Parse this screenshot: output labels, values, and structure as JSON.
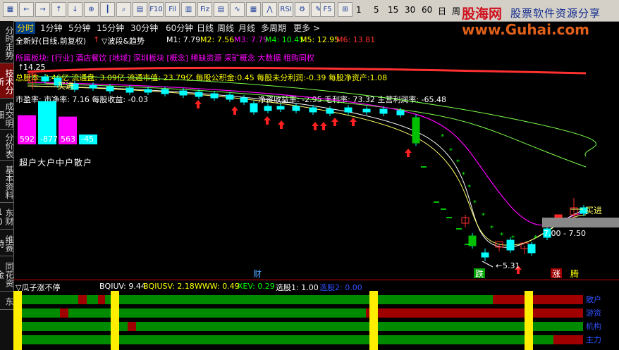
{
  "toolbar": {
    "icons": [
      {
        "name": "grid-icon",
        "glyph": "▦"
      },
      {
        "name": "left-arrow-icon",
        "glyph": "←"
      },
      {
        "name": "right-arrow-icon",
        "glyph": "→"
      },
      {
        "name": "up-arrow-icon",
        "glyph": "↑"
      },
      {
        "name": "down-arrow-icon",
        "glyph": "↓"
      },
      {
        "name": "zoom-in-icon",
        "glyph": "⊕"
      },
      {
        "name": "candlestick-icon",
        "glyph": "┃"
      },
      {
        "name": "search-icon",
        "glyph": "⌕"
      },
      {
        "name": "layout-icon",
        "glyph": "▤"
      },
      {
        "name": "f10-icon",
        "glyph": "F10"
      },
      {
        "name": "f11-icon",
        "glyph": "Fil"
      },
      {
        "name": "chart-icon",
        "glyph": "▥"
      },
      {
        "name": "fiz-icon",
        "glyph": "Fiz"
      },
      {
        "name": "table-icon",
        "glyph": "▤"
      },
      {
        "name": "line-icon",
        "glyph": "∿"
      },
      {
        "name": "multi-window-icon",
        "glyph": "▦"
      },
      {
        "name": "indicator-icon",
        "glyph": "⋀"
      },
      {
        "name": "rsi-icon",
        "glyph": "RSI"
      },
      {
        "name": "settings-icon",
        "glyph": "⚙"
      },
      {
        "name": "pen-icon",
        "glyph": "✎"
      },
      {
        "name": "f5-icon",
        "glyph": "F5"
      },
      {
        "name": "grid2-icon",
        "glyph": "⊞"
      }
    ],
    "periods": [
      "1",
      "5",
      "15",
      "30",
      "60"
    ],
    "ri": "日",
    "zhou": "周"
  },
  "logo": {
    "cn": "股海网",
    "tagline": "股票软件资源分享",
    "url": "www.Guhai.com"
  },
  "left_tabs": [
    {
      "label": "分时走势",
      "active": false
    },
    {
      "label": "技术分析",
      "active": true
    },
    {
      "label": "成交明细",
      "active": false
    },
    {
      "label": "分价表",
      "active": false
    },
    {
      "label": "基本资料",
      "active": false
    },
    {
      "label": "东财10",
      "active": false
    },
    {
      "label": "维赛特",
      "active": false
    },
    {
      "label": "同花资金",
      "active": false
    },
    {
      "label": "东",
      "active": false
    }
  ],
  "period_tabs": [
    "分时",
    "1分钟",
    "5分钟",
    "15分钟",
    "30分钟",
    "60分钟",
    "日线",
    "周线",
    "月线",
    "多周期",
    "更多 >"
  ],
  "main": {
    "title": "全新好(日线,前复权)",
    "indicator": "▽波段&趋势",
    "ma": [
      {
        "label": "M1: 7.79",
        "color": "#ffffff"
      },
      {
        "label": "M2: 7.56",
        "color": "#ffff00"
      },
      {
        "label": "M3: 7.79",
        "color": "#ff00ff"
      },
      {
        "label": "M4: 10.45",
        "color": "#00ff00"
      },
      {
        "label": "M5: 12.95",
        "color": "#ffff00"
      },
      {
        "label": "M6: 13.81",
        "color": "#ff3030"
      }
    ],
    "sector": "所属板块: [行业] 酒店餐饮 [地域] 深圳板块 [概念] 稀缺资源 采矿概念 大数据 租购同权",
    "stats1": "总股本: 3.46亿 流通盘: 3.09亿 流通市值: 23.79亿 每股公积金:0.45 每股未分利润:-0.39 每股净资产:1.08",
    "stats2": "市盈率: 市净率: 7.16 每股收益: -0.03",
    "stats3": "净资收益率: -2.95 毛利率: 73.32 主营利润率: -65.48",
    "high_label": "14.25",
    "buy_label_top": "买进",
    "buy_label_right": "买进",
    "target_label": "7.00 - 7.50",
    "low_label": "5.31",
    "cai": "财",
    "die": "跌",
    "zhang": "涨",
    "teng": "腾"
  },
  "bars": [
    {
      "label": "592",
      "value": 592,
      "color": "#ff00ff"
    },
    {
      "label": "-877",
      "value": -877,
      "color": "#00ffff"
    },
    {
      "label": "563",
      "value": 563,
      "color": "#ff00ff"
    },
    {
      "label": "-45",
      "value": -45,
      "color": "#00ffff"
    }
  ],
  "bars_caption": "超户大户中户散户",
  "sub": {
    "title": "▽瓜子涨不停",
    "values": [
      {
        "label": "BQIUV: 9.44",
        "color": "#ffffff"
      },
      {
        "label": "BQIUSV: 2.18",
        "color": "#ffff00"
      },
      {
        "label": "WWW: 0.49",
        "color": "#ffff00"
      },
      {
        "label": "XEV: 0.29",
        "color": "#00ff00"
      },
      {
        "label": "选股1: 1.00",
        "color": "#ffffff"
      },
      {
        "label": "选股2: 0.00",
        "color": "#3050ff"
      }
    ],
    "row_labels": [
      "散户",
      "游资",
      "机构",
      "主力"
    ]
  },
  "colors": {
    "up": "#ff3030",
    "down": "#00ffff",
    "down_fill": "#00c000"
  }
}
